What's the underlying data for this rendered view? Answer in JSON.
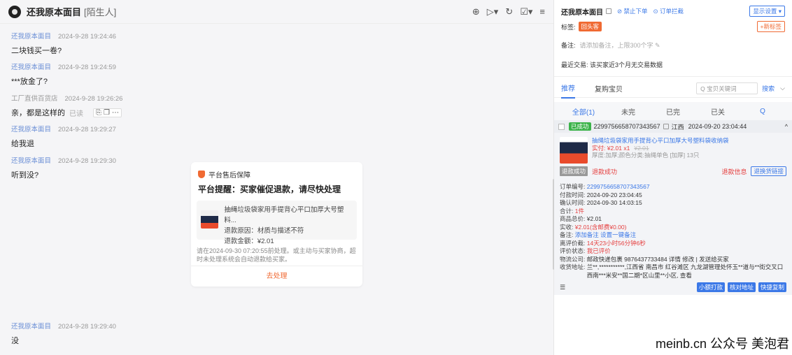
{
  "chat": {
    "title": "还我原本面目",
    "title_tag": "[陌生人]",
    "tools": [
      "⊕",
      "▷▾",
      "↻",
      "☑▾",
      "≡"
    ],
    "messages": [
      {
        "sender": "还我原本面目",
        "time": "2024-9-28 19:24:46",
        "text": "二块钱买一卷?"
      },
      {
        "sender": "还我原本面目",
        "time": "2024-9-28 19:24:59",
        "text": "***放金了?"
      },
      {
        "sender": "工厂直供百货店",
        "time": "2024-9-28 19:26:26",
        "text": "亲，都是这样的",
        "read": "已读"
      },
      {
        "sender": "还我原本面目",
        "time": "2024-9-28 19:29:27",
        "text": "给我退"
      },
      {
        "sender": "还我原本面目",
        "time": "2024-9-28 19:29:30",
        "text": "听到没?"
      },
      {
        "sender": "还我原本面目",
        "time": "2024-9-28 19:29:40",
        "text": "没"
      }
    ],
    "card": {
      "header": "平台售后保障",
      "title": "平台提醒：买家催促退款，请尽快处理",
      "product": "抽绳垃圾袋家用手提背心平口加厚大号塑料...",
      "reason": "退款原因：材质与描述不符",
      "amount": "退款金额：¥2.01",
      "note": "请在2024-09-30 07:20:55前处理。或主动与买家协商，超时未处理系统会自动退款给买家。",
      "action": "去处理"
    }
  },
  "panel": {
    "name": "还我原本面目",
    "link1": "⊘ 禁止下单",
    "link2": "⊙ 订单拦截",
    "display_btn": "显示设置 ▾",
    "tag_label": "标签:",
    "tag": "回头客",
    "new_tag": "+新标签",
    "note_label": "备注:",
    "note_placeholder": "请添加备注，上限300个字 ✎",
    "recent": "最近交易: 该买家近3个月无交易数据",
    "tabs": [
      "推荐",
      "复购宝贝"
    ],
    "search_placeholder": "Q 宝贝关键词",
    "search_btn": "搜索",
    "subtabs": [
      "全部(1)",
      "未完",
      "已完",
      "已关",
      "Q"
    ],
    "order": {
      "status": "已成功",
      "order_no": "2299756658707343567",
      "province": "江西",
      "time": "2024-09-20 23:04:44",
      "product": "抽绳垃圾袋家用手提背心平口加厚大号塑料袋收纳袋",
      "paid": "实付: ¥2.01 x1",
      "orig": "¥2.01",
      "spec": "厚度:加厚;颜色分类:抽绳单色 [加厚] 13只",
      "refund_tag": "退款成功",
      "refund_status": "退款成功",
      "refund_info": "退款信息",
      "refund_btn": "退换货链接",
      "details": [
        {
          "k": "订单编号:",
          "v": "2299756658707343567"
        },
        {
          "k": "付款时间:",
          "v": "2024-09-20 23:04:45"
        },
        {
          "k": "确认时间:",
          "v": "2024-09-30 14:03:15"
        },
        {
          "k": "合计:",
          "v": "1件"
        },
        {
          "k": "商品总价:",
          "v": "¥2.01"
        },
        {
          "k": "实收:",
          "v": "¥2.01(含邮费¥0.00)"
        },
        {
          "k": "备注:",
          "v": "添加备注  设置一键备注"
        },
        {
          "k": "离评价截:",
          "v": "14天23小时56分钟6秒"
        },
        {
          "k": "评价状态:",
          "v": "我已评价"
        },
        {
          "k": "物流公司:",
          "v": "邮政快递包裹 9876437733484  详情 修改 | 发送给买家"
        },
        {
          "k": "收货地址:",
          "v": "兰**,***********,江西省 南昌市 红谷滩区 九龙湖管理处怀玉**道与**街交叉口西南***米安**国二期*区山里**小区, 查看"
        }
      ],
      "bottom_btns": [
        "小额打款",
        "核对地址",
        "快捷复制"
      ]
    }
  },
  "watermark": "meinb.cn 公众号 美泡君"
}
